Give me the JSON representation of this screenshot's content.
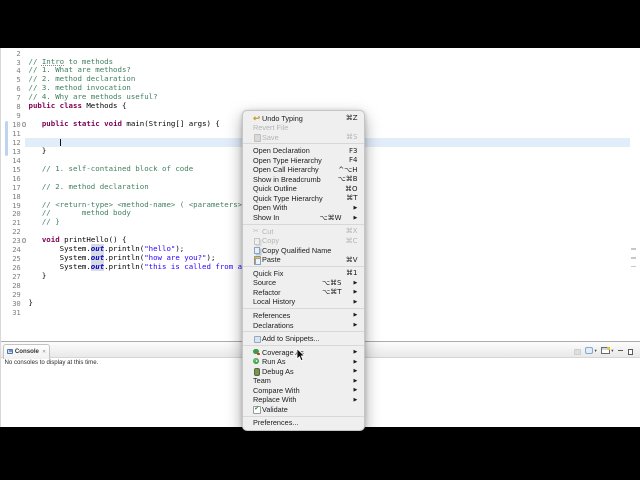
{
  "editor": {
    "lines": [
      {
        "n": 2,
        "segs": []
      },
      {
        "n": 3,
        "segs": [
          [
            "com",
            "// "
          ],
          [
            "com_spell",
            "Intro"
          ],
          [
            "com",
            " to methods"
          ]
        ]
      },
      {
        "n": 4,
        "segs": [
          [
            "com",
            "// 1. What are methods?"
          ]
        ]
      },
      {
        "n": 5,
        "segs": [
          [
            "com",
            "// 2. method declaration"
          ]
        ]
      },
      {
        "n": 6,
        "segs": [
          [
            "com",
            "// 3. method invocation"
          ]
        ]
      },
      {
        "n": 7,
        "segs": [
          [
            "com",
            "// 4. Why are methods useful?"
          ]
        ]
      },
      {
        "n": 8,
        "segs": [
          [
            "kw",
            "public"
          ],
          [
            "pl",
            " "
          ],
          [
            "kw",
            "class"
          ],
          [
            "pl",
            " Methods {"
          ]
        ]
      },
      {
        "n": 9,
        "segs": []
      },
      {
        "n": 10,
        "segs": [
          [
            "pl",
            "   "
          ],
          [
            "kw",
            "public"
          ],
          [
            "pl",
            " "
          ],
          [
            "kw",
            "static"
          ],
          [
            "pl",
            " "
          ],
          [
            "kw",
            "void"
          ],
          [
            "pl",
            " main(String[] args) {"
          ]
        ]
      },
      {
        "n": 11,
        "segs": []
      },
      {
        "n": 12,
        "segs": [
          [
            "pl",
            "       "
          ]
        ]
      },
      {
        "n": 13,
        "segs": [
          [
            "pl",
            "   }"
          ]
        ]
      },
      {
        "n": 14,
        "segs": []
      },
      {
        "n": 15,
        "segs": [
          [
            "pl",
            "   "
          ],
          [
            "com",
            "// 1. self-contained block of code"
          ]
        ]
      },
      {
        "n": 16,
        "segs": []
      },
      {
        "n": 17,
        "segs": [
          [
            "pl",
            "   "
          ],
          [
            "com",
            "// 2. method declaration"
          ]
        ]
      },
      {
        "n": 18,
        "segs": []
      },
      {
        "n": 19,
        "segs": [
          [
            "pl",
            "   "
          ],
          [
            "com",
            "// <return-type> <method-name> ( <parameters> ) {"
          ]
        ]
      },
      {
        "n": 20,
        "segs": [
          [
            "pl",
            "   "
          ],
          [
            "com",
            "//       method body"
          ]
        ]
      },
      {
        "n": 21,
        "segs": [
          [
            "pl",
            "   "
          ],
          [
            "com",
            "// }"
          ]
        ]
      },
      {
        "n": 22,
        "segs": []
      },
      {
        "n": 23,
        "segs": [
          [
            "pl",
            "   "
          ],
          [
            "kw",
            "void"
          ],
          [
            "pl",
            " printHello() {"
          ]
        ]
      },
      {
        "n": 24,
        "segs": [
          [
            "pl",
            "       System."
          ],
          [
            "fld",
            "out"
          ],
          [
            "pl",
            ".println("
          ],
          [
            "str",
            "\"hello\""
          ],
          [
            "pl",
            ");"
          ]
        ]
      },
      {
        "n": 25,
        "segs": [
          [
            "pl",
            "       System."
          ],
          [
            "fld",
            "out"
          ],
          [
            "pl",
            ".println("
          ],
          [
            "str",
            "\"how are you?\""
          ],
          [
            "pl",
            ");"
          ]
        ]
      },
      {
        "n": 26,
        "segs": [
          [
            "pl",
            "       System."
          ],
          [
            "fld",
            "out"
          ],
          [
            "pl",
            ".println("
          ],
          [
            "str",
            "\"this is called from a method\""
          ],
          [
            "pl",
            ");"
          ]
        ]
      },
      {
        "n": 27,
        "segs": [
          [
            "pl",
            "   }"
          ]
        ]
      },
      {
        "n": 28,
        "segs": []
      },
      {
        "n": 29,
        "segs": []
      },
      {
        "n": 30,
        "segs": [
          [
            "pl",
            "}"
          ]
        ]
      },
      {
        "n": 31,
        "segs": []
      }
    ],
    "fold_marker_lines": [
      10,
      23
    ],
    "range_indicator": {
      "from_line": 10,
      "to_line": 13
    },
    "cursor": {
      "line": 12,
      "col": 7
    },
    "occurrence_marker_lines": [
      24,
      25,
      26
    ]
  },
  "console": {
    "tab_label": "Console",
    "close_label": "✕",
    "empty_message": "No consoles to display at this time.",
    "toolbar": [
      {
        "name": "pin-console",
        "disabled": true
      },
      {
        "name": "display-selected-console",
        "dropdown": true
      },
      {
        "name": "open-console",
        "dropdown": true
      },
      {
        "name": "minimize"
      },
      {
        "name": "maximize"
      }
    ],
    "dropdown_glyph": "▾"
  },
  "menu": {
    "items": [
      {
        "label": "Undo Typing",
        "shortcut": "⌘Z",
        "icon": "undo"
      },
      {
        "label": "Revert File",
        "disabled": true
      },
      {
        "label": "Save",
        "shortcut": "⌘S",
        "icon": "save",
        "disabled": true
      },
      {
        "sep": true
      },
      {
        "label": "Open Declaration",
        "shortcut": "F3"
      },
      {
        "label": "Open Type Hierarchy",
        "shortcut": "F4"
      },
      {
        "label": "Open Call Hierarchy",
        "shortcut": "^⌥H"
      },
      {
        "label": "Show in Breadcrumb",
        "shortcut": "⌥⌘B"
      },
      {
        "label": "Quick Outline",
        "shortcut": "⌘O"
      },
      {
        "label": "Quick Type Hierarchy",
        "shortcut": "⌘T"
      },
      {
        "label": "Open With",
        "submenu": true
      },
      {
        "label": "Show In",
        "shortcut": "⌥⌘W",
        "submenu": true
      },
      {
        "sep": true
      },
      {
        "label": "Cut",
        "shortcut": "⌘X",
        "icon": "cut",
        "disabled": true
      },
      {
        "label": "Copy",
        "shortcut": "⌘C",
        "icon": "copy",
        "disabled": true
      },
      {
        "label": "Copy Qualified Name",
        "icon": "copyq"
      },
      {
        "label": "Paste",
        "shortcut": "⌘V",
        "icon": "paste"
      },
      {
        "sep": true
      },
      {
        "label": "Quick Fix",
        "shortcut": "⌘1"
      },
      {
        "label": "Source",
        "shortcut": "⌥⌘S",
        "submenu": true
      },
      {
        "label": "Refactor",
        "shortcut": "⌥⌘T",
        "submenu": true
      },
      {
        "label": "Local History",
        "submenu": true
      },
      {
        "sep": true
      },
      {
        "label": "References",
        "submenu": true
      },
      {
        "label": "Declarations",
        "submenu": true
      },
      {
        "sep": true
      },
      {
        "label": "Add to Snippets...",
        "icon": "snip"
      },
      {
        "sep": true
      },
      {
        "label": "Coverage As",
        "icon": "cov",
        "submenu": true
      },
      {
        "label": "Run As",
        "icon": "run",
        "submenu": true
      },
      {
        "label": "Debug As",
        "icon": "debug",
        "submenu": true
      },
      {
        "label": "Team",
        "submenu": true
      },
      {
        "label": "Compare With",
        "submenu": true
      },
      {
        "label": "Replace With",
        "submenu": true
      },
      {
        "label": "Validate",
        "icon": "val"
      },
      {
        "sep": true
      },
      {
        "label": "Preferences...",
        "icon": null
      }
    ],
    "submenu_glyph": "▶",
    "icon_glyphs": {
      "undo": "↩",
      "cut": "✂"
    }
  },
  "colors": {
    "keyword": "#7f0055",
    "comment": "#3f7f5f",
    "string": "#2a00ff",
    "static_field": "#0000c0",
    "current_line": "#e2edfa",
    "menu_bg": "#efefef",
    "letterbox": "#000000"
  }
}
